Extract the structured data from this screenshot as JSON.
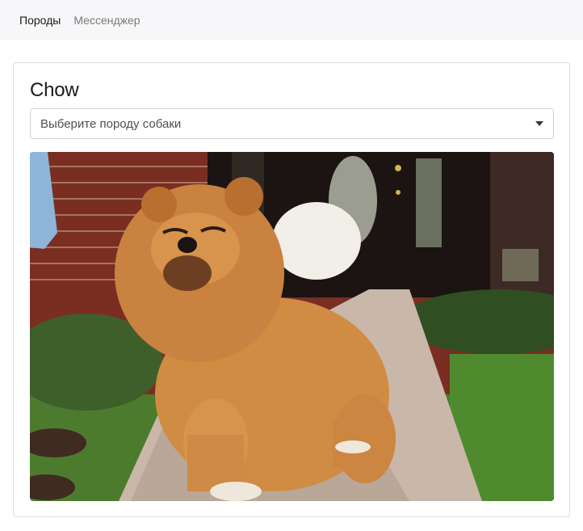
{
  "nav": {
    "items": [
      {
        "label": "Породы",
        "active": true
      },
      {
        "label": "Мессенджер",
        "active": false
      }
    ]
  },
  "breed": {
    "title": "Chow",
    "select_placeholder": "Выберите породу собаки",
    "image_alt": "Chow"
  },
  "colors": {
    "navbar_bg": "#f7f7f9",
    "card_border": "#dcdcdc",
    "text": "#212529"
  }
}
